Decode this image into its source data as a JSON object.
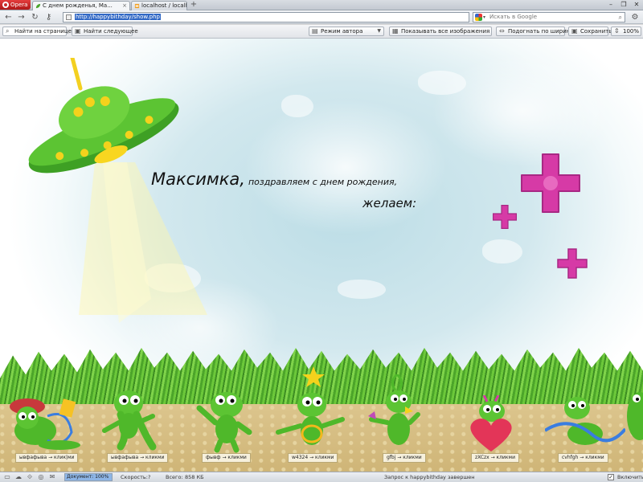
{
  "tabs": {
    "opera_label": "Opera",
    "items": [
      {
        "title": "С днем рожденья, Ма...",
        "active": true
      },
      {
        "title": "localhost / localhost / t...",
        "active": false
      }
    ],
    "new_tab_glyph": "+"
  },
  "address_bar": {
    "url": "http://happybithday/show.php",
    "search_placeholder": "Искать в Google",
    "search_engine_icon": "google-icon"
  },
  "find_bar": {
    "find_label": "Найти на странице",
    "find_next_label": "Найти следующее",
    "author_mode_label": "Режим автора",
    "show_images_label": "Показывать все изображения",
    "fit_width_label": "Подогнать по ширине",
    "save_label": "Сохранить",
    "zoom_label": "100%"
  },
  "page": {
    "name": "Максимка,",
    "congrats": "поздравляем с днем рождения,",
    "wish": "желаем:"
  },
  "aliens": [
    {
      "label": "ывфафыва → клик|ми"
    },
    {
      "label": "ывфафыва → кликми"
    },
    {
      "label": "фывф → кликми"
    },
    {
      "label": "w4324 → кликми"
    },
    {
      "label": "gfbj → кликми"
    },
    {
      "label": "zXCzx → кликми"
    },
    {
      "label": "cvhfgh → кликми"
    }
  ],
  "status_bar": {
    "document_label": "Документ:",
    "document_progress": "100%",
    "document_fraction": 1.0,
    "speed_label": "Скорость:",
    "speed_value": "?",
    "total_label": "Всего:",
    "total_value": "858 КБ",
    "status_message": "Запрос к happybithday завершен",
    "enable_label": "Включить"
  },
  "colors": {
    "alien_green": "#4fb82a",
    "ufo_yellow": "#f4d21c",
    "cross_magenta": "#d63aa6",
    "heart_red": "#e33558"
  }
}
